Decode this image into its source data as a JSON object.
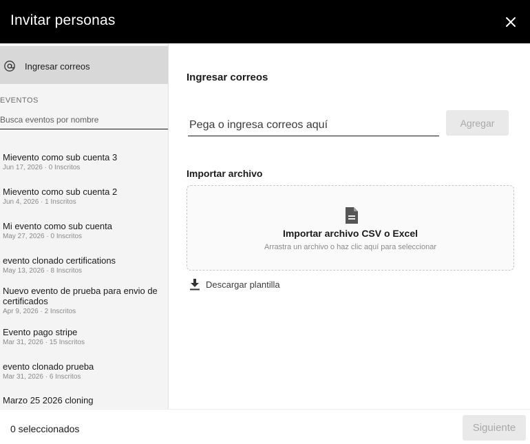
{
  "header": {
    "title": "Invitar personas",
    "close_icon": "close-icon"
  },
  "sidebar": {
    "email_option": {
      "label": "Ingresar correos",
      "icon": "at-icon"
    },
    "events_section_label": "EVENTOS",
    "search_placeholder": "Busca eventos por nombre",
    "events": [
      {
        "name": "Mievento como sub cuenta 3",
        "meta": "Jun 17, 2026 · 0 Inscritos"
      },
      {
        "name": "Mievento como sub cuenta 2",
        "meta": "Jun 4, 2026 · 1 Inscritos"
      },
      {
        "name": "Mi evento como sub cuenta",
        "meta": "May 27, 2026 · 0 Inscritos"
      },
      {
        "name": "evento clonado certifications",
        "meta": "May 13, 2026 · 8 Inscritos"
      },
      {
        "name": "Nuevo evento de prueba para envio de certificados",
        "meta": "Apr 9, 2026 · 2 Inscritos"
      },
      {
        "name": "Evento pago stripe",
        "meta": "Mar 31, 2026 · 15 Inscritos"
      },
      {
        "name": "evento clonado prueba",
        "meta": "Mar 31, 2026 · 6 Inscritos"
      },
      {
        "name": "Marzo 25 2026 cloning",
        "meta": ""
      }
    ]
  },
  "main": {
    "title": "Ingresar correos",
    "email_placeholder": "Pega o ingresa correos aquí",
    "add_label": "Agregar",
    "import_label": "Importar archivo",
    "dropzone": {
      "icon": "file-icon",
      "title": "Importar archivo CSV o Excel",
      "subtitle": "Arrastra un archivo o haz clic aquí para seleccionar"
    },
    "download": {
      "icon": "download-icon",
      "label": "Descargar plantilla"
    }
  },
  "footer": {
    "selected_count": "0 seleccionados",
    "next_label": "Siguiente"
  },
  "colors": {
    "header_bg": "#000000",
    "sidebar_bg": "#f4f4f4",
    "sidebar_active_bg": "#d8d8d8",
    "disabled_button_bg": "#e9e9e9",
    "disabled_button_text": "#a8a8a8"
  }
}
